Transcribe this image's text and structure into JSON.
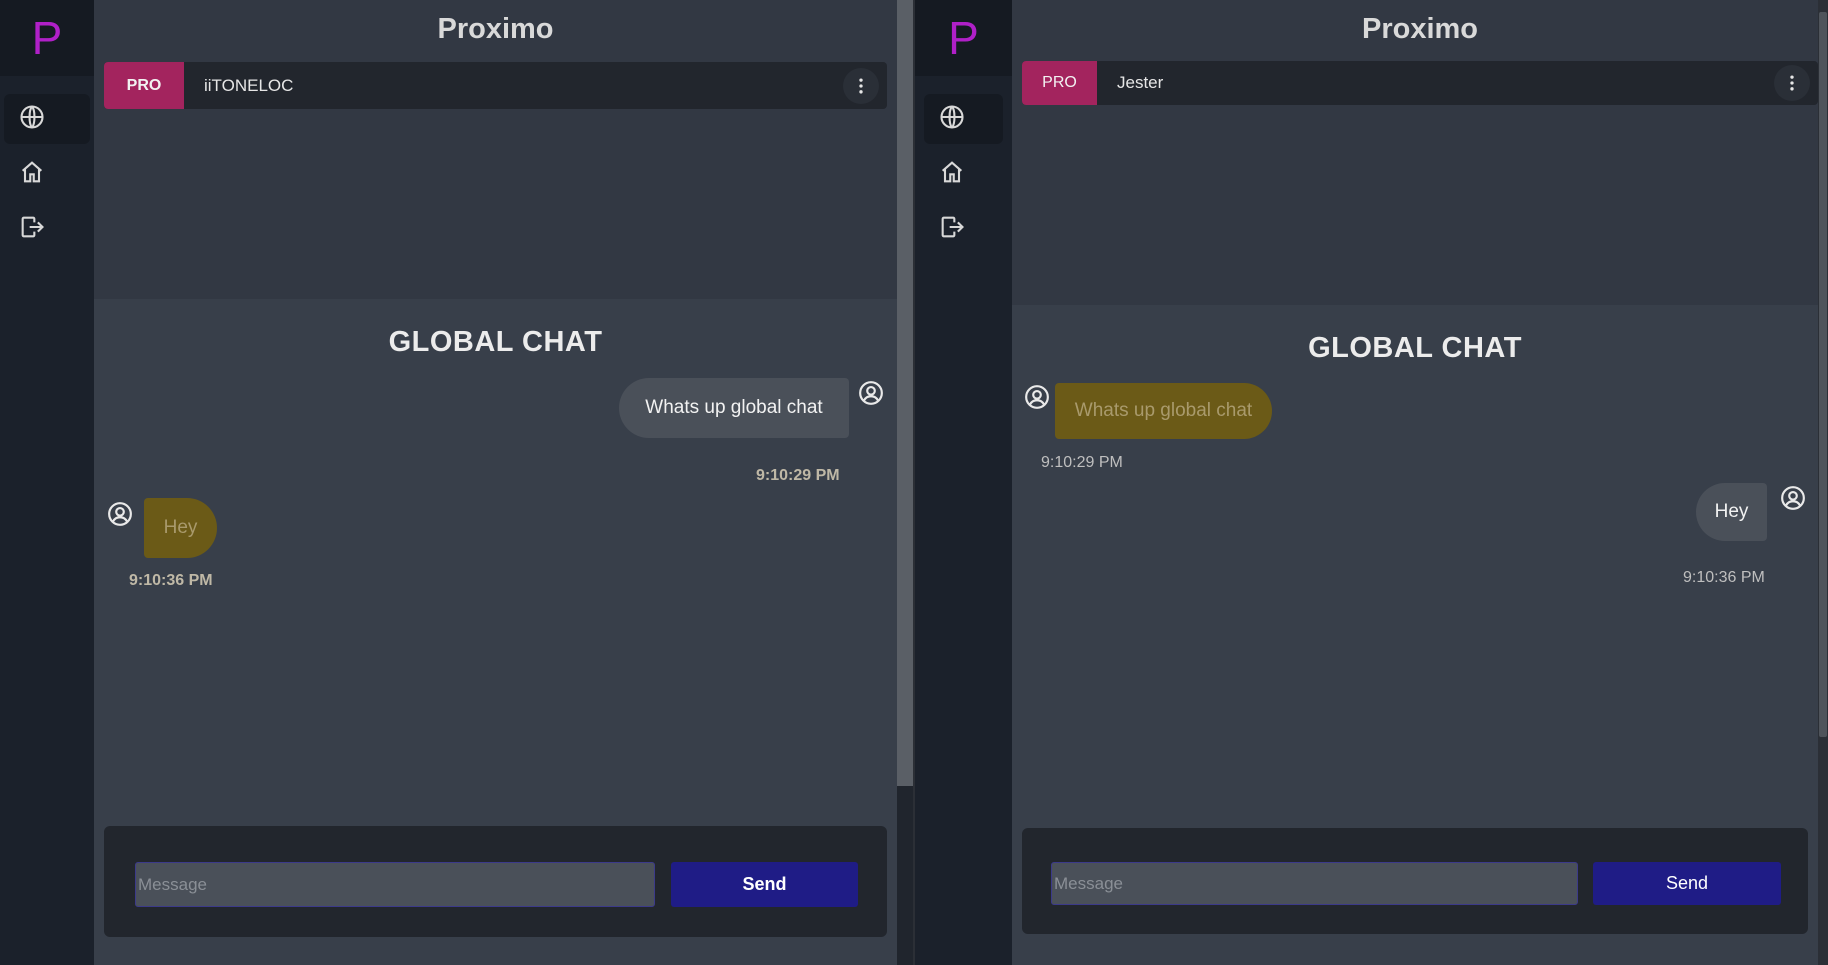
{
  "left_window": {
    "logo_letter": "P",
    "app_title": "Proximo",
    "badge": "PRO",
    "username": "iiTONELOC",
    "section_title": "GLOBAL CHAT",
    "messages": [
      {
        "text": "Whats up global chat",
        "time": "9:10:29 PM",
        "side": "right"
      },
      {
        "text": "Hey",
        "time": "9:10:36 PM",
        "side": "left"
      }
    ],
    "composer": {
      "placeholder": "Message",
      "send_label": "Send"
    }
  },
  "right_window": {
    "logo_letter": "P",
    "app_title": "Proximo",
    "badge": "PRO",
    "username": "Jester",
    "section_title": "GLOBAL CHAT",
    "messages": [
      {
        "text": "Whats up global chat",
        "time": "9:10:29 PM",
        "side": "left"
      },
      {
        "text": "Hey",
        "time": "9:10:36 PM",
        "side": "right"
      }
    ],
    "composer": {
      "placeholder": "Message",
      "send_label": "Send"
    }
  },
  "nav_icons": [
    "globe-icon",
    "home-icon",
    "logout-icon"
  ],
  "colors": {
    "brand_magenta": "#b020c8",
    "pro_badge": "#a3245e",
    "send_button": "#1f1c86",
    "own_bubble": "#4a5059",
    "other_bubble": "#6b5a17"
  }
}
